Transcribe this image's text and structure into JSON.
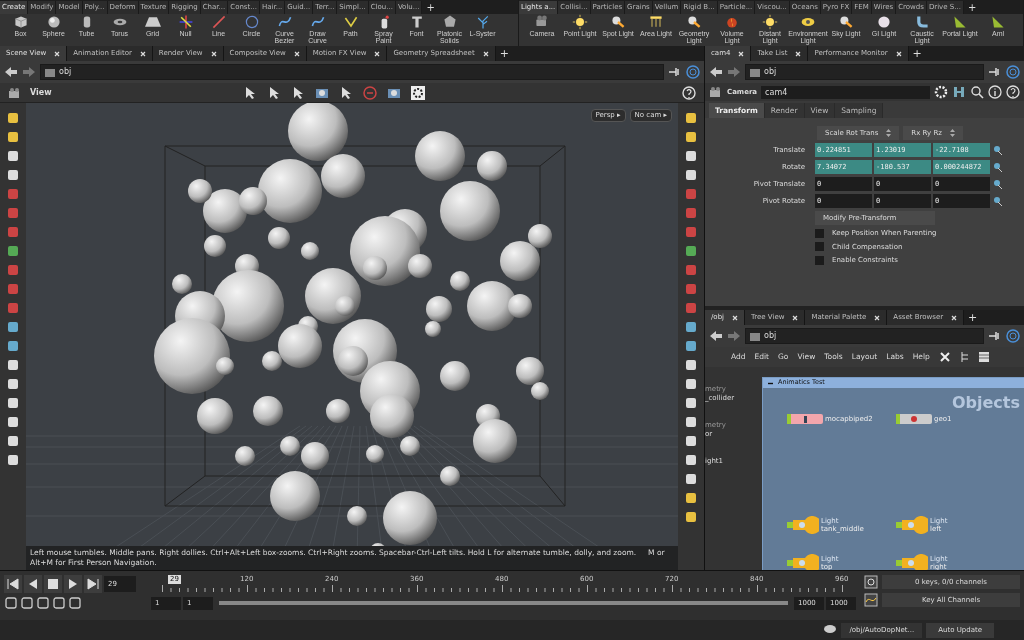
{
  "shelf_left": {
    "tabs": [
      {
        "label": "Create",
        "selected": true
      },
      {
        "label": "Modify",
        "selected": false
      },
      {
        "label": "Model",
        "selected": false
      },
      {
        "label": "Poly...",
        "selected": false
      },
      {
        "label": "Deform",
        "selected": false
      },
      {
        "label": "Texture",
        "selected": false
      },
      {
        "label": "Rigging",
        "selected": false
      },
      {
        "label": "Char...",
        "selected": false
      },
      {
        "label": "Const...",
        "selected": false
      },
      {
        "label": "Hair...",
        "selected": false
      },
      {
        "label": "Guid...",
        "selected": false
      },
      {
        "label": "Terr...",
        "selected": false
      },
      {
        "label": "Simpl...",
        "selected": false
      },
      {
        "label": "Clou...",
        "selected": false
      },
      {
        "label": "Volu...",
        "selected": false
      }
    ],
    "add_tab": "+",
    "tools": [
      "Box",
      "Sphere",
      "Tube",
      "Torus",
      "Grid",
      "Null",
      "Line",
      "Circle",
      "Curve Bezier",
      "Draw Curve",
      "Path",
      "Spray Paint",
      "Font",
      "Platonic Solids",
      "L-Syster"
    ]
  },
  "shelf_right": {
    "tabs": [
      {
        "label": "Lights a...",
        "selected": true
      },
      {
        "label": "Collisi...",
        "selected": false
      },
      {
        "label": "Particles",
        "selected": false
      },
      {
        "label": "Grains",
        "selected": false
      },
      {
        "label": "Vellum",
        "selected": false
      },
      {
        "label": "Rigid B...",
        "selected": false
      },
      {
        "label": "Particle...",
        "selected": false
      },
      {
        "label": "Viscou...",
        "selected": false
      },
      {
        "label": "Oceans",
        "selected": false
      },
      {
        "label": "Pyro FX",
        "selected": false
      },
      {
        "label": "FEM",
        "selected": false
      },
      {
        "label": "Wires",
        "selected": false
      },
      {
        "label": "Crowds",
        "selected": false
      },
      {
        "label": "Drive S...",
        "selected": false
      }
    ],
    "add_tab": "+",
    "tools": [
      "Camera",
      "Point Light",
      "Spot Light",
      "Area Light",
      "Geometry Light",
      "Volume Light",
      "Distant Light",
      "Environment Light",
      "Sky Light",
      "GI Light",
      "Caustic Light",
      "Portal Light",
      "Aml"
    ]
  },
  "scene_pane": {
    "tabs": [
      {
        "label": "Scene View",
        "selected": true
      },
      {
        "label": "Animation Editor",
        "selected": false
      },
      {
        "label": "Render View",
        "selected": false
      },
      {
        "label": "Composite View",
        "selected": false
      },
      {
        "label": "Motion FX View",
        "selected": false
      },
      {
        "label": "Geometry Spreadsheet",
        "selected": false
      }
    ],
    "add_tab": "+",
    "path": "obj",
    "view_title": "View",
    "camera_buttons": [
      "Persp ▸",
      "No cam ▸"
    ],
    "help_text": "Left mouse tumbles. Middle pans. Right dollies. Ctrl+Alt+Left box-zooms. Ctrl+Right zooms. Spacebar-Ctrl-Left tilts. Hold L for alternate tumble, dolly, and zoom.     M or Alt+M for First Person Navigation."
  },
  "param_pane": {
    "tabs": [
      {
        "label": "cam4",
        "selected": true
      },
      {
        "label": "Take List",
        "selected": false
      },
      {
        "label": "Performance Monitor",
        "selected": false
      }
    ],
    "add_tab": "+",
    "path": "obj",
    "node_type": "Camera",
    "node_name": "cam4",
    "param_tabs": [
      {
        "label": "Transform",
        "selected": true
      },
      {
        "label": "Render",
        "selected": false
      },
      {
        "label": "View",
        "selected": false
      },
      {
        "label": "Sampling",
        "selected": false
      }
    ],
    "transform_order": [
      "Scale Rot Trans",
      "Rx Ry Rz"
    ],
    "rows": [
      {
        "label": "Translate",
        "animated": true,
        "values": [
          "0.224851",
          "1.23019",
          "-22.7108"
        ]
      },
      {
        "label": "Rotate",
        "animated": true,
        "values": [
          "7.34072",
          "-180.537",
          "0.000244872"
        ]
      },
      {
        "label": "Pivot Translate",
        "animated": false,
        "values": [
          "0",
          "0",
          "0"
        ]
      },
      {
        "label": "Pivot Rotate",
        "animated": false,
        "values": [
          "0",
          "0",
          "0"
        ]
      }
    ],
    "menu": "Modify Pre-Transform",
    "checkboxes": [
      {
        "label": "Keep Position When Parenting",
        "checked": false
      },
      {
        "label": "Child Compensation",
        "checked": false
      },
      {
        "label": "Enable Constraints",
        "checked": false
      }
    ]
  },
  "network_pane": {
    "tabs": [
      {
        "label": "/obj",
        "selected": true
      },
      {
        "label": "Tree View",
        "selected": false
      },
      {
        "label": "Material Palette",
        "selected": false
      },
      {
        "label": "Asset Browser",
        "selected": false
      }
    ],
    "add_tab": "+",
    "path": "obj",
    "menu": [
      "Add",
      "Edit",
      "Go",
      "View",
      "Tools",
      "Layout",
      "Labs",
      "Help"
    ],
    "context_label": "Objects",
    "box_title": "Animatics Test",
    "outside_nodes": [
      {
        "type": "metry",
        "name": "_collider"
      },
      {
        "type": "metry",
        "name": "or"
      },
      {
        "name": "ight1"
      }
    ],
    "nodes": [
      {
        "kind": "subnet",
        "name": "mocapbiped2"
      },
      {
        "kind": "geo",
        "name": "geo1"
      },
      {
        "kind": "light",
        "type": "Light",
        "name": "tank_middle"
      },
      {
        "kind": "light",
        "type": "Light",
        "name": "left"
      },
      {
        "kind": "light",
        "type": "Light",
        "name": "top"
      },
      {
        "kind": "light",
        "type": "Light",
        "name": "right"
      }
    ]
  },
  "timeline": {
    "frame": "29",
    "frame_marker": "29",
    "range_slider": {
      "level": 1
    },
    "ticks": [
      "120",
      "240",
      "360",
      "480",
      "600",
      "720",
      "840",
      "960"
    ],
    "range": [
      "1",
      "1",
      "1000",
      "1000"
    ],
    "keys": "0 keys, 0/0 channels",
    "key_mode": "Key All Channels"
  },
  "status_bar": {
    "path": "/obj/AutoDopNet...",
    "update": "Auto Update"
  }
}
